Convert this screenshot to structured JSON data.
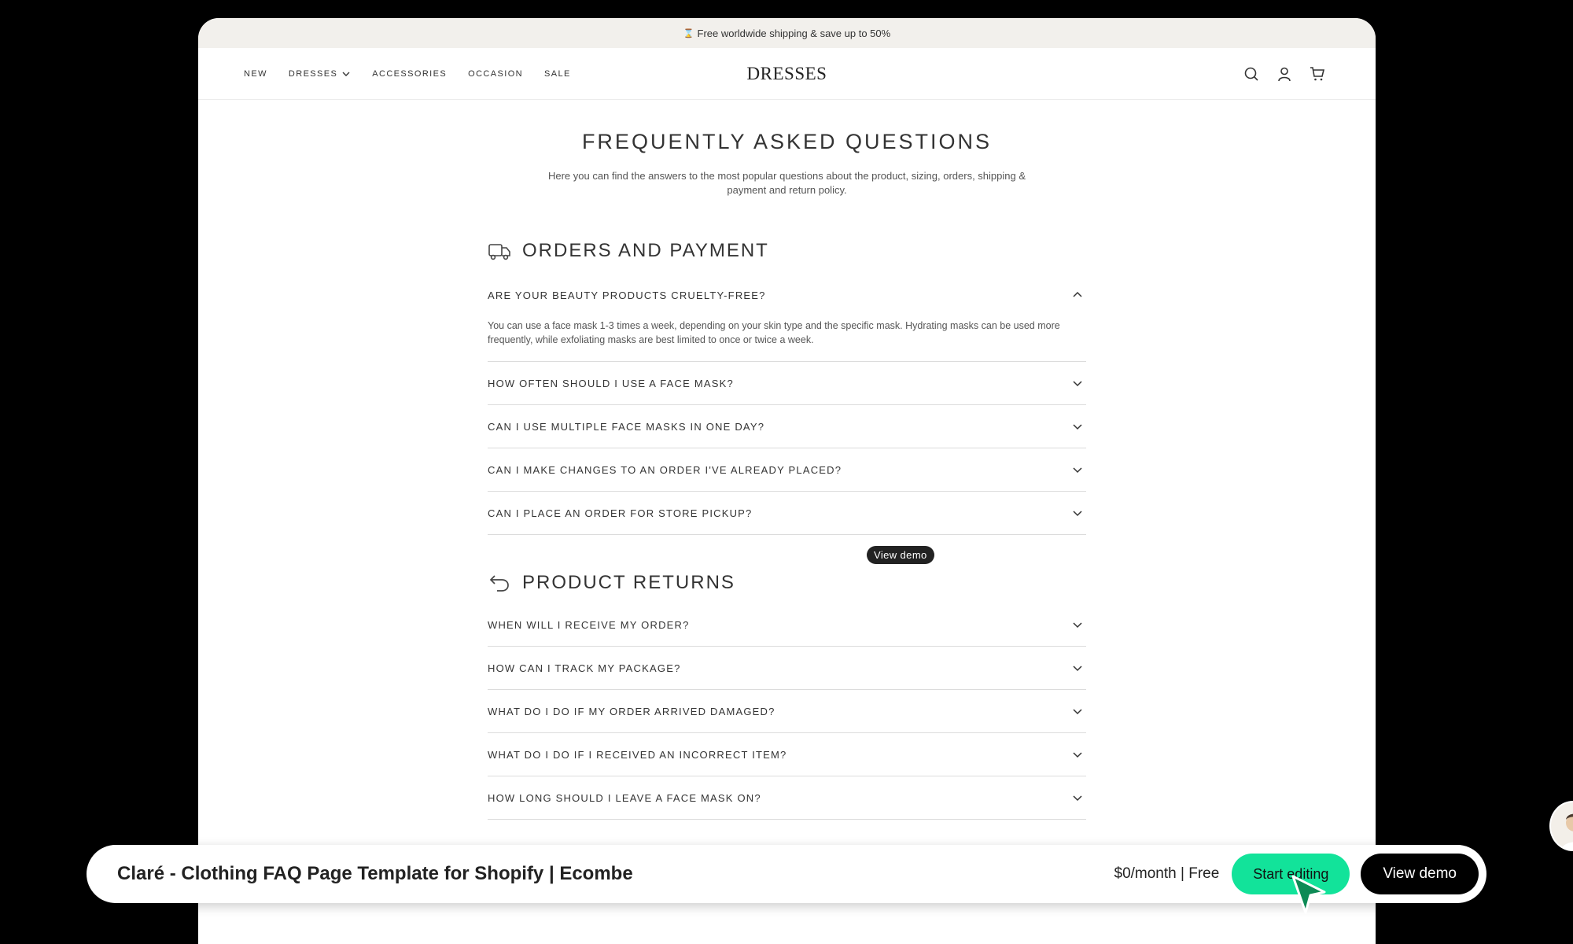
{
  "announcement": {
    "icon": "hourglass-icon",
    "text": "Free worldwide shipping & save up to 50%"
  },
  "nav": {
    "links": [
      "NEW",
      "DRESSES",
      "ACCESSORIES",
      "OCCASION",
      "SALE"
    ],
    "brand": "DRESSES",
    "icons": [
      "search-icon",
      "account-icon",
      "cart-icon"
    ]
  },
  "faq": {
    "title": "FREQUENTLY ASKED QUESTIONS",
    "subtitle": "Here you can find the answers to the most popular questions about the product, sizing, orders, shipping & payment and return policy."
  },
  "sections": [
    {
      "title": "ORDERS AND PAYMENT",
      "icon": "truck-icon",
      "open_question": "ARE YOUR BEAUTY PRODUCTS CRUELTY-FREE?",
      "open_answer": "You can use a face mask 1-3 times a week, depending on your skin type and the specific mask. Hydrating masks can be used more frequently, while exfoliating masks are best limited to once or twice a week.",
      "questions": [
        "HOW OFTEN SHOULD I USE A FACE MASK?",
        "CAN I USE MULTIPLE FACE MASKS IN ONE DAY?",
        "CAN I MAKE CHANGES TO AN ORDER I'VE ALREADY PLACED?",
        "CAN I PLACE AN ORDER FOR STORE PICKUP?"
      ]
    },
    {
      "title": "PRODUCT RETURNS",
      "icon": "return-arrow-icon",
      "questions": [
        "WHEN WILL I RECEIVE MY ORDER?",
        "HOW CAN I TRACK MY PACKAGE?",
        "WHAT DO I DO IF MY ORDER ARRIVED DAMAGED?",
        "WHAT DO I DO IF I RECEIVED AN INCORRECT ITEM?",
        "HOW LONG SHOULD I LEAVE A FACE MASK ON?"
      ]
    }
  ],
  "demo_pill": "View demo",
  "bottom_bar": {
    "title": "Claré - Clothing FAQ Page Template for Shopify | Ecombe",
    "price": "$0/month | Free",
    "start_label": "Start editing",
    "view_label": "View demo",
    "accent": "#12e39a"
  }
}
